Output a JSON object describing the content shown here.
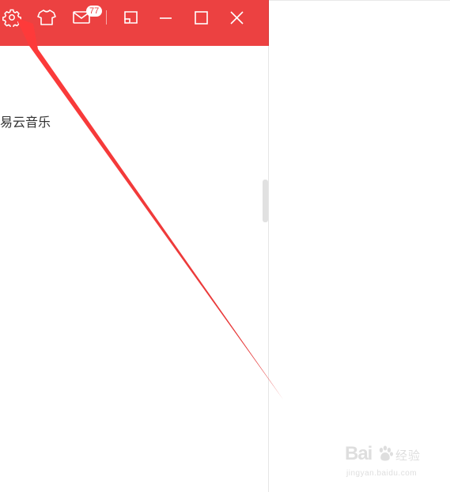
{
  "titlebar": {
    "background": "#ec4141",
    "icons": [
      "gear-icon",
      "tshirt-icon",
      "mail-icon",
      "mini-mode-icon",
      "minimize-icon",
      "maximize-icon",
      "close-icon"
    ],
    "mail_badge": "77"
  },
  "content": {
    "partial_text": "易云音乐"
  },
  "annotation": {
    "arrow_color": "#ee3b3b"
  },
  "watermark": {
    "logo": "Bai",
    "site_cn": "经验",
    "url": "jingyan.baidu.com"
  }
}
